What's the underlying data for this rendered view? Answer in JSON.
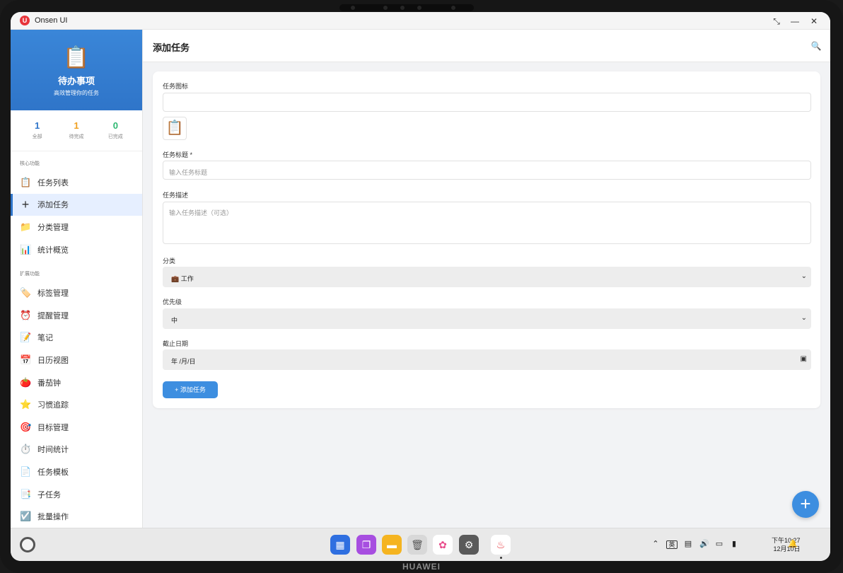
{
  "window": {
    "title": "Onsen UI",
    "logo_text": "U"
  },
  "sidebar": {
    "title": "待办事项",
    "subtitle": "高效管理你的任务",
    "logo_icon": "📋",
    "stats": [
      {
        "value": "1",
        "label": "全部",
        "color": "#2f75c9"
      },
      {
        "value": "1",
        "label": "待完成",
        "color": "#f0a020"
      },
      {
        "value": "0",
        "label": "已完成",
        "color": "#2eb872"
      }
    ],
    "section_core": "核心功能",
    "core_items": [
      {
        "icon": "📋",
        "label": "任务列表"
      },
      {
        "icon": "+",
        "label": "添加任务"
      },
      {
        "icon": "📁",
        "label": "分类管理"
      },
      {
        "icon": "📊",
        "label": "统计概览"
      }
    ],
    "section_ext": "扩展功能",
    "ext_items": [
      {
        "icon": "🏷️",
        "label": "标签管理"
      },
      {
        "icon": "⏰",
        "label": "提醒管理"
      },
      {
        "icon": "📝",
        "label": "笔记"
      },
      {
        "icon": "📅",
        "label": "日历视图"
      },
      {
        "icon": "🍅",
        "label": "番茄钟"
      },
      {
        "icon": "⭐",
        "label": "习惯追踪"
      },
      {
        "icon": "🎯",
        "label": "目标管理"
      },
      {
        "icon": "⏱️",
        "label": "时间统计"
      },
      {
        "icon": "📄",
        "label": "任务模板"
      },
      {
        "icon": "📑",
        "label": "子任务"
      },
      {
        "icon": "☑️",
        "label": "批量操作"
      }
    ]
  },
  "header": {
    "title": "添加任务"
  },
  "form": {
    "icon_label": "任务图标",
    "icon_value": "",
    "icon_preview": "📋",
    "title_label": "任务标题 *",
    "title_placeholder": "输入任务标题",
    "desc_label": "任务描述",
    "desc_placeholder": "输入任务描述（可选）",
    "category_label": "分类",
    "category_value": "💼 工作",
    "priority_label": "优先级",
    "priority_value": "中",
    "due_label": "截止日期",
    "due_value": "年 /月/日",
    "submit_label": "+ 添加任务"
  },
  "fab": {
    "label": "+"
  },
  "taskbar": {
    "clock_time": "下午10:27",
    "clock_date": "12月10日",
    "ime": "英",
    "dock": [
      {
        "icon": "grid-icon",
        "glyph": "▦",
        "color": "#2f6fe0"
      },
      {
        "icon": "window-icon",
        "glyph": "❐",
        "color": "#a74ee0"
      },
      {
        "icon": "folder-icon",
        "glyph": "▬",
        "color": "#f5b420"
      },
      {
        "icon": "trash-icon",
        "glyph": "🗑",
        "color": "#d8d8d8"
      },
      {
        "icon": "gallery-icon",
        "glyph": "✿",
        "color": "#ffffff"
      },
      {
        "icon": "settings-icon",
        "glyph": "⚙",
        "color": "#5a5a5a"
      },
      {
        "icon": "onsen-icon",
        "glyph": "♨",
        "color": "#ffffff"
      }
    ]
  },
  "device": {
    "brand": "HUAWEI"
  }
}
